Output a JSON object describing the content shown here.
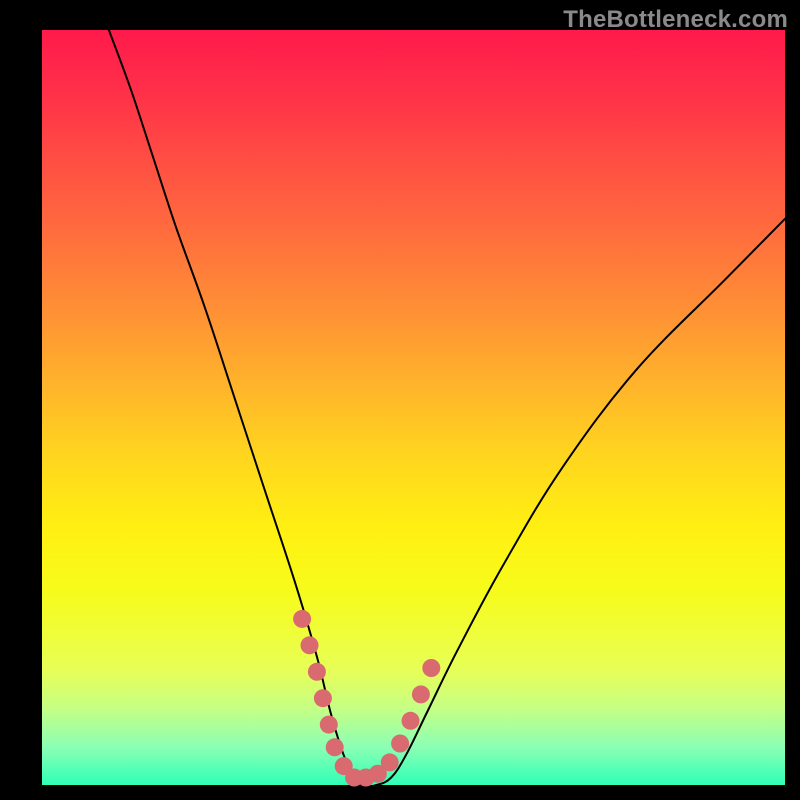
{
  "watermark": "TheBottleneck.com",
  "colors": {
    "curve": "#000000",
    "marker": "#d96a6f",
    "gradient_top": "#ff1a4b",
    "gradient_bottom": "#2fffb7",
    "page_bg": "#000000"
  },
  "chart_data": {
    "type": "line",
    "title": "",
    "xlabel": "",
    "ylabel": "",
    "xlim": [
      0,
      100
    ],
    "ylim": [
      0,
      100
    ],
    "grid": false,
    "legend": false,
    "axes_visible": false,
    "background": "rainbow-gradient (red top → green bottom)",
    "curve_description": "Single black V-shaped curve dipping to the bottom near x≈42 with a flat minimum, asymmetric arms (left arm steeper, right arm shallower).",
    "series": [
      {
        "name": "bottleneck-curve",
        "x": [
          9,
          12,
          15,
          18,
          22,
          26,
          30,
          34,
          37,
          39,
          41,
          43,
          45,
          47,
          49,
          52,
          56,
          62,
          70,
          80,
          92,
          100
        ],
        "y": [
          100,
          92,
          83,
          74,
          63,
          51,
          39,
          27,
          17,
          9,
          3,
          0,
          0,
          1,
          4,
          10,
          18,
          29,
          42,
          55,
          67,
          75
        ]
      }
    ],
    "markers": [
      {
        "x": 35.0,
        "y": 22.0
      },
      {
        "x": 36.0,
        "y": 18.5
      },
      {
        "x": 37.0,
        "y": 15.0
      },
      {
        "x": 37.8,
        "y": 11.5
      },
      {
        "x": 38.6,
        "y": 8.0
      },
      {
        "x": 39.4,
        "y": 5.0
      },
      {
        "x": 40.6,
        "y": 2.5
      },
      {
        "x": 42.0,
        "y": 1.0
      },
      {
        "x": 43.6,
        "y": 1.0
      },
      {
        "x": 45.2,
        "y": 1.5
      },
      {
        "x": 46.8,
        "y": 3.0
      },
      {
        "x": 48.2,
        "y": 5.5
      },
      {
        "x": 49.6,
        "y": 8.5
      },
      {
        "x": 51.0,
        "y": 12.0
      },
      {
        "x": 52.4,
        "y": 15.5
      }
    ]
  }
}
